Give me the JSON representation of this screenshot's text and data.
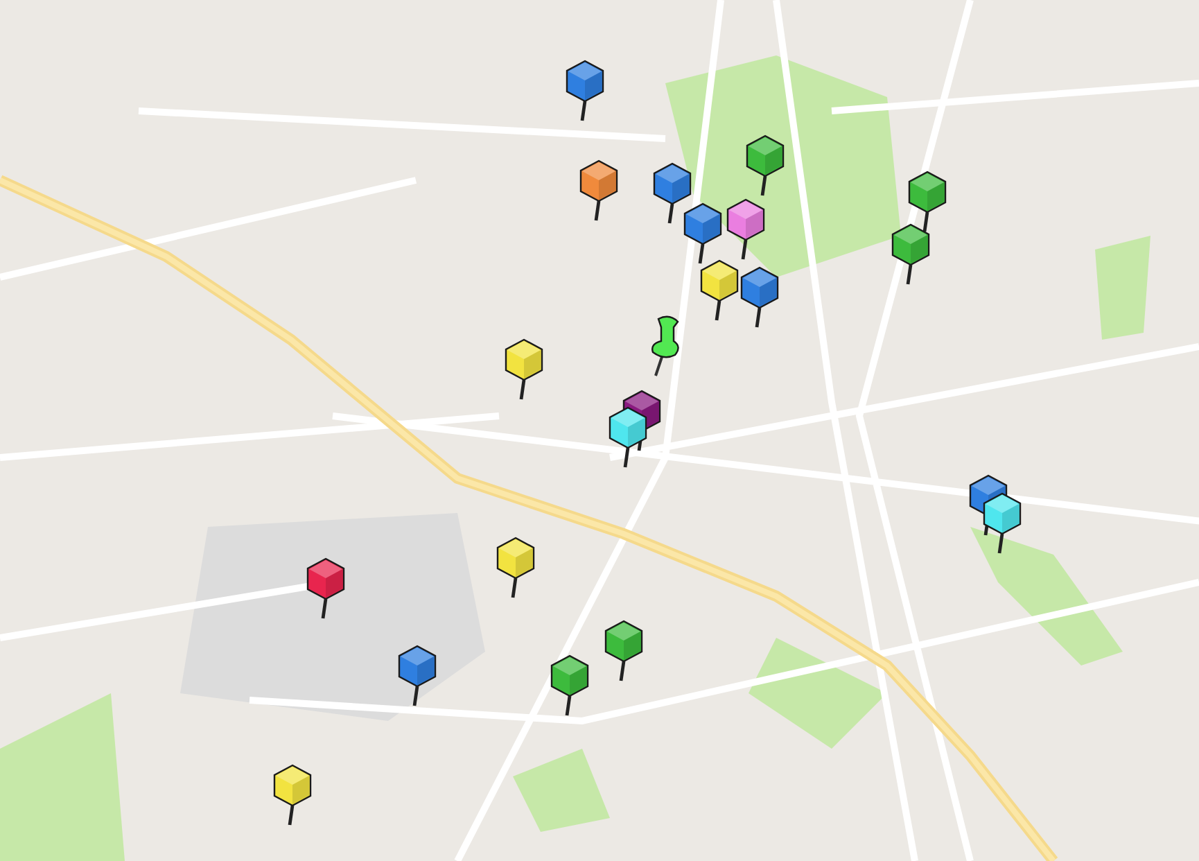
{
  "map": {
    "pins": [
      {
        "kind": "cube",
        "color": "#2f7fe0"
      },
      {
        "kind": "cube",
        "color": "#f08a3c"
      },
      {
        "kind": "cube",
        "color": "#2f7fe0"
      },
      {
        "kind": "cube",
        "color": "#3dbb3d"
      },
      {
        "kind": "cube",
        "color": "#2f7fe0"
      },
      {
        "kind": "cube",
        "color": "#ea7ee0"
      },
      {
        "kind": "cube",
        "color": "#f2e340"
      },
      {
        "kind": "cube",
        "color": "#3dbb3d"
      },
      {
        "kind": "cube",
        "color": "#3dbb3d"
      },
      {
        "kind": "cube",
        "color": "#2f7fe0"
      },
      {
        "kind": "cube",
        "color": "#f2e340"
      },
      {
        "kind": "pushpin",
        "color": "#52e852"
      },
      {
        "kind": "cube",
        "color": "#8a1a80"
      },
      {
        "kind": "cube",
        "color": "#4fe6ee"
      },
      {
        "kind": "cube",
        "color": "#2f7fe0"
      },
      {
        "kind": "cube",
        "color": "#4fe6ee"
      },
      {
        "kind": "cube",
        "color": "#f2e340"
      },
      {
        "kind": "cube",
        "color": "#e8254e"
      },
      {
        "kind": "cube",
        "color": "#3dbb3d"
      },
      {
        "kind": "cube",
        "color": "#3dbb3d"
      },
      {
        "kind": "cube",
        "color": "#2f7fe0"
      },
      {
        "kind": "cube",
        "color": "#f2e340"
      }
    ]
  }
}
